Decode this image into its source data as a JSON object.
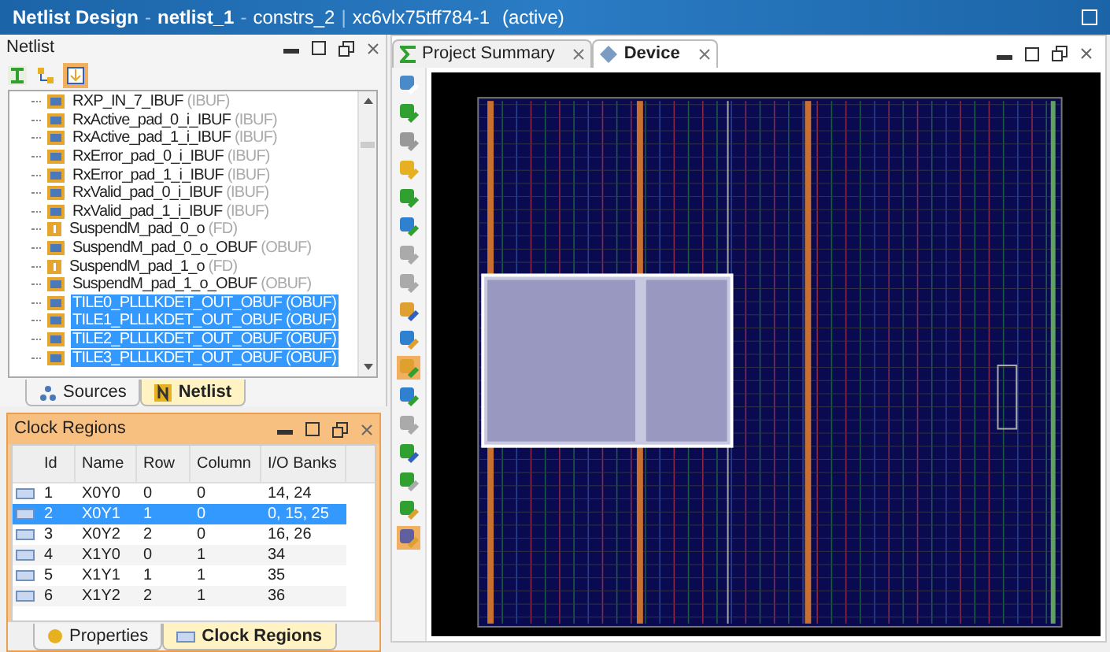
{
  "window": {
    "title": "Netlist Design",
    "separator_1": "-",
    "design": "netlist_1",
    "separator_2": "-",
    "constraints": "constrs_2",
    "separator_3": "|",
    "part": "xc6vlx75tff784-1",
    "status": "(active)"
  },
  "netlist": {
    "title": "Netlist",
    "items": [
      {
        "name": "RXP_IN_7_IBUF",
        "type": "(IBUF)",
        "kind": "buffer",
        "selected": false
      },
      {
        "name": "RxActive_pad_0_i_IBUF",
        "type": "(IBUF)",
        "kind": "buffer",
        "selected": false
      },
      {
        "name": "RxActive_pad_1_i_IBUF",
        "type": "(IBUF)",
        "kind": "buffer",
        "selected": false
      },
      {
        "name": "RxError_pad_0_i_IBUF",
        "type": "(IBUF)",
        "kind": "buffer",
        "selected": false
      },
      {
        "name": "RxError_pad_1_i_IBUF",
        "type": "(IBUF)",
        "kind": "buffer",
        "selected": false
      },
      {
        "name": "RxValid_pad_0_i_IBUF",
        "type": "(IBUF)",
        "kind": "buffer",
        "selected": false
      },
      {
        "name": "RxValid_pad_1_i_IBUF",
        "type": "(IBUF)",
        "kind": "buffer",
        "selected": false
      },
      {
        "name": "SuspendM_pad_0_o",
        "type": "(FD)",
        "kind": "flipflop",
        "selected": false
      },
      {
        "name": "SuspendM_pad_0_o_OBUF",
        "type": "(OBUF)",
        "kind": "buffer",
        "selected": false
      },
      {
        "name": "SuspendM_pad_1_o",
        "type": "(FD)",
        "kind": "flipflop",
        "selected": false
      },
      {
        "name": "SuspendM_pad_1_o_OBUF",
        "type": "(OBUF)",
        "kind": "buffer",
        "selected": false
      },
      {
        "name": "TILE0_PLLLKDET_OUT_OBUF",
        "type": "(OBUF)",
        "kind": "buffer",
        "selected": true
      },
      {
        "name": "TILE1_PLLLKDET_OUT_OBUF",
        "type": "(OBUF)",
        "kind": "buffer",
        "selected": true
      },
      {
        "name": "TILE2_PLLLKDET_OUT_OBUF",
        "type": "(OBUF)",
        "kind": "buffer",
        "selected": true
      },
      {
        "name": "TILE3_PLLLKDET_OUT_OBUF",
        "type": "(OBUF)",
        "kind": "buffer",
        "selected": true
      }
    ],
    "tabs": [
      {
        "label": "Sources",
        "selected": false
      },
      {
        "label": "Netlist",
        "selected": true
      }
    ]
  },
  "clock_regions": {
    "title": "Clock Regions",
    "columns": [
      "Id",
      "Name",
      "Row",
      "Column",
      "I/O Banks"
    ],
    "rows": [
      {
        "cells": [
          "1",
          "X0Y0",
          "0",
          "0",
          "14, 24"
        ],
        "selected": false
      },
      {
        "cells": [
          "2",
          "X0Y1",
          "1",
          "0",
          "0, 15, 25"
        ],
        "selected": true
      },
      {
        "cells": [
          "3",
          "X0Y2",
          "2",
          "0",
          "16, 26"
        ],
        "selected": false
      },
      {
        "cells": [
          "4",
          "X1Y0",
          "0",
          "1",
          "34"
        ],
        "selected": false
      },
      {
        "cells": [
          "5",
          "X1Y1",
          "1",
          "1",
          "35"
        ],
        "selected": false
      },
      {
        "cells": [
          "6",
          "X1Y2",
          "2",
          "1",
          "36"
        ],
        "selected": false
      }
    ],
    "tabs": [
      {
        "label": "Properties",
        "selected": false
      },
      {
        "label": "Clock Regions",
        "selected": true
      }
    ]
  },
  "editor": {
    "tabs": [
      {
        "label": "Project Summary",
        "selected": false
      },
      {
        "label": "Device",
        "selected": true
      }
    ]
  }
}
